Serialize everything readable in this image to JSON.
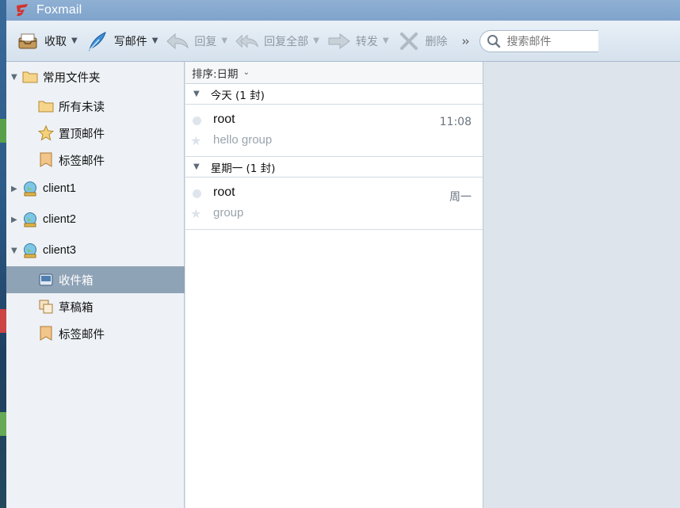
{
  "window": {
    "title": "Foxmail"
  },
  "toolbar": {
    "receive": "收取",
    "compose": "写邮件",
    "reply": "回复",
    "reply_all": "回复全部",
    "forward": "转发",
    "delete": "删除",
    "more": "››",
    "search_placeholder": "搜索邮件"
  },
  "sidebar": {
    "common_folders": "常用文件夹",
    "all_unread": "所有未读",
    "pinned": "置顶邮件",
    "tagged": "标签邮件",
    "accounts": [
      "client1",
      "client2",
      "client3"
    ],
    "inbox": "收件箱",
    "drafts": "草稿箱",
    "tagged2": "标签邮件"
  },
  "list": {
    "sort_label": "排序:日期",
    "groups": [
      {
        "label": "今天 (1 封)",
        "messages": [
          {
            "from": "root",
            "subject": "hello group",
            "time": "11:08"
          }
        ]
      },
      {
        "label": "星期一 (1 封)",
        "messages": [
          {
            "from": "root",
            "subject": "group",
            "time": "周一"
          }
        ]
      }
    ]
  },
  "colors": {
    "selected": "#8fa3b6",
    "titlebar": "#7fa3cb",
    "brand": "#d4322c"
  }
}
